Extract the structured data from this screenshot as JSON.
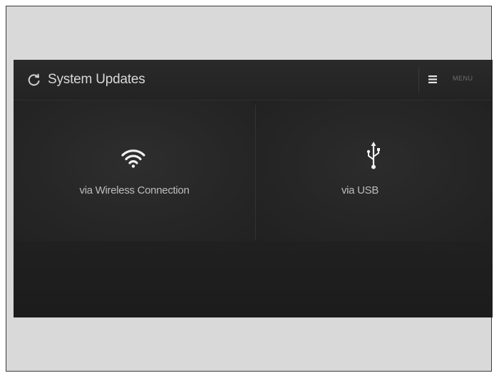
{
  "header": {
    "title": "System Updates",
    "refresh_icon": "refresh-icon",
    "menu_label": "MENU",
    "menu_icon": "hamburger-menu-icon"
  },
  "options": [
    {
      "label": "via Wireless Connection",
      "icon": "wifi-icon"
    },
    {
      "label": "via USB",
      "icon": "usb-icon"
    }
  ],
  "colors": {
    "background_outer": "#d9d9d9",
    "screen_background": "#1f1f1f",
    "text_primary": "#d8d8d8",
    "text_secondary": "#6f6f6f",
    "icon_color": "#f0f0f0"
  }
}
